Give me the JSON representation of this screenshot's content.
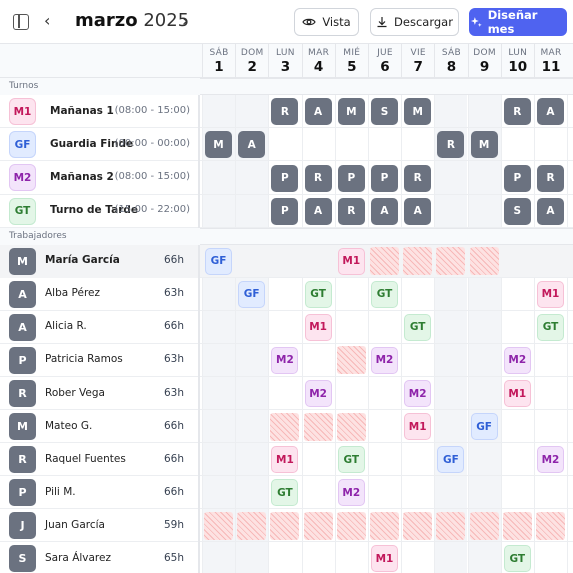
{
  "header": {
    "month": "marzo",
    "year": "2025",
    "prev_icon": "chevron-left-icon",
    "next_icon": "chevron-right-icon",
    "view_button": "Vista",
    "download_button": "Descargar",
    "design_button": "Diseñar mes"
  },
  "days": [
    {
      "dow": "SÁB",
      "num": "1"
    },
    {
      "dow": "DOM",
      "num": "2"
    },
    {
      "dow": "LUN",
      "num": "3"
    },
    {
      "dow": "MAR",
      "num": "4"
    },
    {
      "dow": "MIÉ",
      "num": "5"
    },
    {
      "dow": "JUE",
      "num": "6"
    },
    {
      "dow": "VIE",
      "num": "7"
    },
    {
      "dow": "SÁB",
      "num": "8"
    },
    {
      "dow": "DOM",
      "num": "9"
    },
    {
      "dow": "LUN",
      "num": "10"
    },
    {
      "dow": "MAR",
      "num": "11"
    }
  ],
  "sections": {
    "shifts": "Turnos",
    "workers": "Trabajadores"
  },
  "shifts": [
    {
      "code": "M1",
      "name": "Mañanas 1",
      "time": "(08:00 - 15:00)",
      "cells": [
        "",
        "",
        "R",
        "A",
        "M",
        "S",
        "M",
        "",
        "",
        "R",
        "A"
      ]
    },
    {
      "code": "GF",
      "name": "Guardia Finde",
      "time": "(00:00 - 00:00)",
      "cells": [
        "M",
        "A",
        "",
        "",
        "",
        "",
        "",
        "R",
        "M",
        "",
        ""
      ]
    },
    {
      "code": "M2",
      "name": "Mañanas 2",
      "time": "(08:00 - 15:00)",
      "cells": [
        "",
        "",
        "P",
        "R",
        "P",
        "P",
        "R",
        "",
        "",
        "P",
        "R"
      ]
    },
    {
      "code": "GT",
      "name": "Turno de Tarde",
      "time": "(15:00 - 22:00)",
      "cells": [
        "",
        "",
        "P",
        "A",
        "R",
        "A",
        "A",
        "",
        "",
        "S",
        "A"
      ]
    }
  ],
  "workers": [
    {
      "initial": "M",
      "name": "María García",
      "hours": "66h",
      "cells": [
        "GF",
        "",
        "",
        "",
        "M1",
        "x",
        "x",
        "x",
        "x",
        "",
        ""
      ]
    },
    {
      "initial": "A",
      "name": "Alba Pérez",
      "hours": "63h",
      "cells": [
        "",
        "GF",
        "",
        "GT",
        "",
        "GT",
        "",
        "",
        "",
        "",
        "M1"
      ]
    },
    {
      "initial": "A",
      "name": "Alicia R.",
      "hours": "66h",
      "cells": [
        "",
        "",
        "",
        "M1",
        "",
        "",
        "GT",
        "",
        "",
        "",
        "GT"
      ]
    },
    {
      "initial": "P",
      "name": "Patricia Ramos",
      "hours": "63h",
      "cells": [
        "",
        "",
        "M2",
        "",
        "x",
        "M2",
        "",
        "",
        "",
        "M2",
        ""
      ]
    },
    {
      "initial": "R",
      "name": "Rober Vega",
      "hours": "63h",
      "cells": [
        "",
        "",
        "",
        "M2",
        "",
        "",
        "M2",
        "",
        "",
        "M1",
        ""
      ]
    },
    {
      "initial": "M",
      "name": "Mateo G.",
      "hours": "66h",
      "cells": [
        "",
        "",
        "x",
        "x",
        "x",
        "",
        "M1",
        "",
        "GF",
        "",
        ""
      ]
    },
    {
      "initial": "R",
      "name": "Raquel Fuentes",
      "hours": "66h",
      "cells": [
        "",
        "",
        "M1",
        "",
        "GT",
        "",
        "",
        "GF",
        "",
        "",
        "M2"
      ]
    },
    {
      "initial": "P",
      "name": "Pili M.",
      "hours": "66h",
      "cells": [
        "",
        "",
        "GT",
        "",
        "M2",
        "",
        "",
        "",
        "",
        "",
        ""
      ]
    },
    {
      "initial": "J",
      "name": "Juan García",
      "hours": "59h",
      "cells": [
        "x",
        "x",
        "x",
        "x",
        "x",
        "x",
        "x",
        "x",
        "x",
        "x",
        "x"
      ]
    },
    {
      "initial": "S",
      "name": "Sara Álvarez",
      "hours": "65h",
      "cells": [
        "",
        "",
        "",
        "",
        "",
        "M1",
        "",
        "",
        "",
        "GT",
        ""
      ]
    }
  ]
}
